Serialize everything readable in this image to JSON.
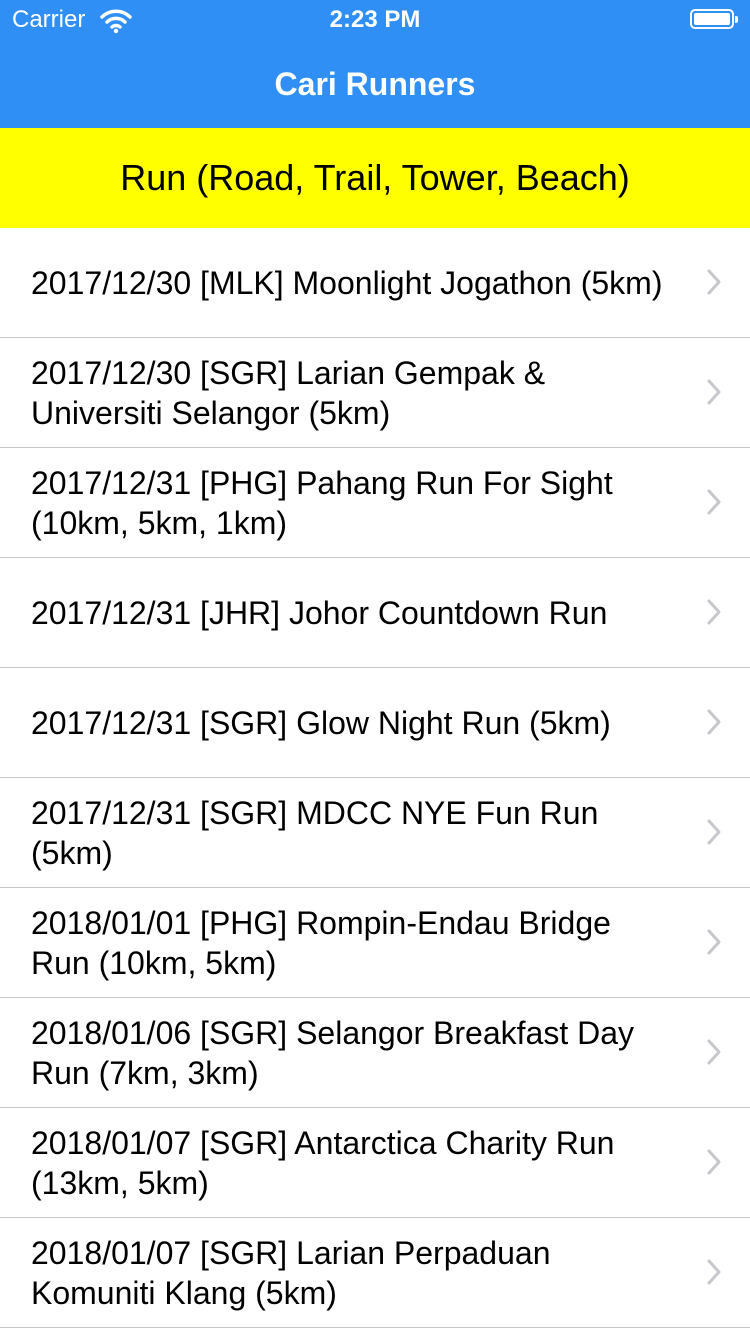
{
  "status_bar": {
    "carrier": "Carrier",
    "time": "2:23 PM",
    "icons": [
      "wifi-icon",
      "battery-icon"
    ]
  },
  "nav": {
    "title": "Cari Runners",
    "color": "#2f8ff5"
  },
  "section": {
    "title": "Run (Road, Trail, Tower, Beach)",
    "color": "#ffff00"
  },
  "events": [
    {
      "label": "2017/12/30 [MLK] Moonlight Jogathon (5km)"
    },
    {
      "label": "2017/12/30 [SGR] Larian Gempak & Universiti Selangor (5km)"
    },
    {
      "label": "2017/12/31 [PHG] Pahang Run For Sight (10km, 5km, 1km)"
    },
    {
      "label": "2017/12/31 [JHR] Johor Countdown Run"
    },
    {
      "label": "2017/12/31 [SGR] Glow Night Run (5km)"
    },
    {
      "label": "2017/12/31 [SGR] MDCC NYE Fun Run (5km)"
    },
    {
      "label": "2018/01/01 [PHG] Rompin-Endau Bridge Run (10km, 5km)"
    },
    {
      "label": "2018/01/06 [SGR] Selangor Breakfast Day Run (7km, 3km)"
    },
    {
      "label": "2018/01/07 [SGR] Antarctica Charity Run (13km, 5km)"
    },
    {
      "label": "2018/01/07 [SGR] Larian Perpaduan Komuniti Klang (5km)"
    }
  ],
  "row_accessory_icon": "chevron-right-icon"
}
